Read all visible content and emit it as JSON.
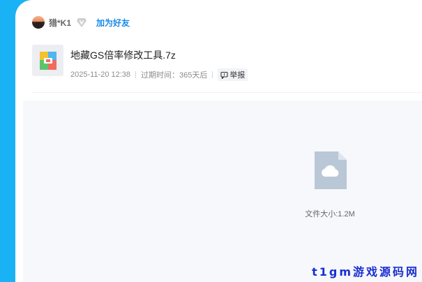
{
  "user": {
    "name": "猎*K1",
    "add_friend_label": "加为好友"
  },
  "file": {
    "name": "地藏GS倍率修改工具.7z",
    "date": "2025-11-20 12:38",
    "expire_label": "过期时间：365天后",
    "report_label": "举报"
  },
  "preview": {
    "size_label": "文件大小:1.2M"
  },
  "watermark": "t1gm游戏源码网",
  "colors": {
    "sidebar": "#19b3f5",
    "link": "#1a8ae5",
    "icon": "#b9c7d6"
  },
  "icons": [
    "avatar",
    "vip-diamond-icon",
    "archive-file-icon",
    "report-icon",
    "cloud-file-icon"
  ]
}
